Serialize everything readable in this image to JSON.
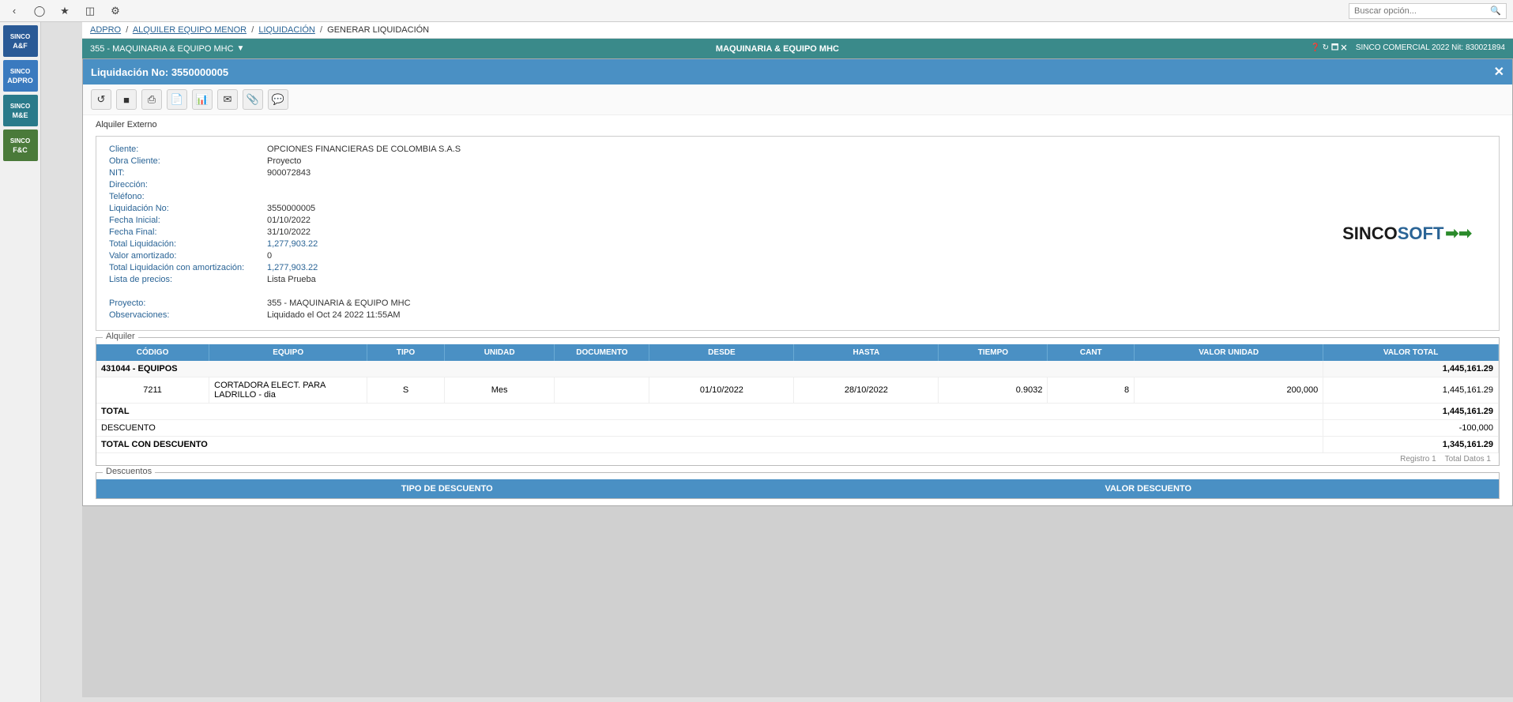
{
  "app": {
    "title": "SINCOSOFT",
    "search_placeholder": "Buscar opción...",
    "company": "SINCO COMERCIAL 2022 Nit: 830021894"
  },
  "sidebar": {
    "items": [
      {
        "id": "af",
        "label": "SINCO",
        "sublabel": "A&F",
        "color": "blue"
      },
      {
        "id": "adpro",
        "label": "SINCO",
        "sublabel": "ADPRO",
        "color": "blue"
      },
      {
        "id": "me",
        "label": "SINCO",
        "sublabel": "M&E",
        "color": "teal"
      },
      {
        "id": "fc",
        "label": "SINCO",
        "sublabel": "F&C",
        "color": "green"
      }
    ]
  },
  "breadcrumb": {
    "items": [
      "ADPRO",
      "ALQUILER EQUIPO MENOR",
      "LIQUIDACIÓN",
      "GENERAR LIQUIDACIÓN"
    ]
  },
  "module_bar": {
    "left": "355 - MAQUINARIA & EQUIPO MHC",
    "center": "MAQUINARIA & EQUIPO MHC",
    "right": "SINCO COMERCIAL 2022 Nit: 830021894"
  },
  "document": {
    "title": "Liquidación No: 3550000005",
    "section_label": "Alquiler Externo"
  },
  "toolbar": {
    "buttons": [
      {
        "id": "undo",
        "icon": "↩",
        "label": "undo-button"
      },
      {
        "id": "save",
        "icon": "💾",
        "label": "save-button"
      },
      {
        "id": "print",
        "icon": "🖨",
        "label": "print-button"
      },
      {
        "id": "pdf",
        "icon": "📄",
        "label": "pdf-button"
      },
      {
        "id": "excel",
        "icon": "📊",
        "label": "excel-button"
      },
      {
        "id": "email",
        "icon": "✉",
        "label": "email-button"
      },
      {
        "id": "attach",
        "icon": "📎",
        "label": "attach-button"
      },
      {
        "id": "notes",
        "icon": "💬",
        "label": "notes-button"
      }
    ]
  },
  "client_info": {
    "fields": [
      {
        "label": "Cliente:",
        "value": "OPCIONES FINANCIERAS DE COLOMBIA S.A.S",
        "blue": false
      },
      {
        "label": "Obra Cliente:",
        "value": "Proyecto",
        "blue": false
      },
      {
        "label": "NIT:",
        "value": "900072843",
        "blue": false
      },
      {
        "label": "Dirección:",
        "value": "",
        "blue": false
      },
      {
        "label": "Teléfono:",
        "value": "",
        "blue": false
      },
      {
        "label": "Liquidación No:",
        "value": "3550000005",
        "blue": false
      },
      {
        "label": "Fecha Inicial:",
        "value": "01/10/2022",
        "blue": false
      },
      {
        "label": "Fecha Final:",
        "value": "31/10/2022",
        "blue": false
      },
      {
        "label": "Total Liquidación:",
        "value": "1,277,903.22",
        "blue": true
      },
      {
        "label": "Valor amortizado:",
        "value": "0",
        "blue": false
      },
      {
        "label": "Total Liquidación con amortización:",
        "value": "1,277,903.22",
        "blue": true
      },
      {
        "label": "Lista de precios:",
        "value": "Lista Prueba",
        "blue": false
      },
      {
        "label": "",
        "value": "",
        "blue": false
      },
      {
        "label": "Proyecto:",
        "value": "355 - MAQUINARIA & EQUIPO MHC",
        "blue": false
      },
      {
        "label": "Observaciones:",
        "value": "Liquidado el Oct 24 2022 11:55AM",
        "blue": false
      }
    ]
  },
  "alquiler_table": {
    "section_label": "Alquiler",
    "columns": [
      "CÓDIGO",
      "EQUIPO",
      "TIPO",
      "UNIDAD",
      "DOCUMENTO",
      "DESDE",
      "HASTA",
      "TIEMPO",
      "CANT",
      "VALOR UNIDAD",
      "VALOR TOTAL"
    ],
    "group_rows": [
      {
        "code": "431044 - EQUIPOS",
        "value": "1,445,161.29"
      }
    ],
    "data_rows": [
      {
        "code": "7211",
        "equipo": "CORTADORA ELECT. PARA LADRILLO - dia",
        "tipo": "S",
        "unidad": "Mes",
        "documento": "",
        "desde": "01/10/2022",
        "hasta": "28/10/2022",
        "tiempo": "0.9032",
        "cant": "8",
        "valor_unidad": "200,000",
        "valor_total": "1,445,161.29"
      }
    ],
    "summary": [
      {
        "label": "TOTAL",
        "value": "1,445,161.29",
        "bold": true
      },
      {
        "label": "DESCUENTO",
        "value": "-100,000",
        "bold": false
      },
      {
        "label": "TOTAL CON DESCUENTO",
        "value": "1,345,161.29",
        "bold": true
      }
    ],
    "records_info": {
      "registro": "Registro 1",
      "total": "Total Datos 1"
    }
  },
  "descuentos_table": {
    "section_label": "Descuentos",
    "columns": [
      "TIPO DE DESCUENTO",
      "VALOR DESCUENTO"
    ]
  }
}
